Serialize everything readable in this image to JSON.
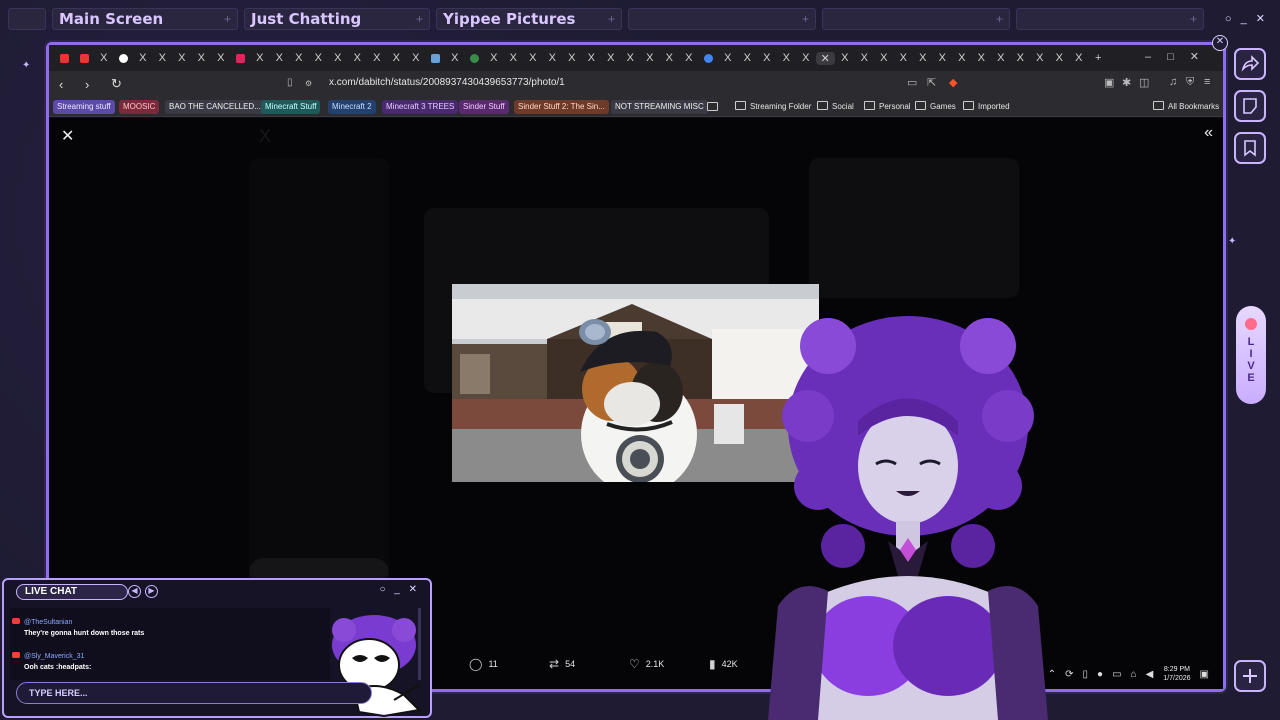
{
  "stream_tabs": [
    {
      "label": ""
    },
    {
      "label": "Main Screen"
    },
    {
      "label": "Just Chatting"
    },
    {
      "label": "Yippee Pictures"
    },
    {
      "label": ""
    },
    {
      "label": ""
    },
    {
      "label": ""
    }
  ],
  "browser": {
    "url": "x.com/dabitch/status/2008937430439653773/photo/1",
    "bookmarks": [
      {
        "label": "Streaming stuff",
        "color": "#5b4aa8",
        "fg": "#f0e6ff"
      },
      {
        "label": "MOOSIC",
        "color": "#7a2a3a",
        "fg": "#ffc2cc"
      },
      {
        "label": "BAO THE CANCELLED...",
        "color": "#3a3a44",
        "fg": "#f0f0f0"
      },
      {
        "label": "Minecraft Stuff",
        "color": "#1f5a5a",
        "fg": "#c8ffff"
      },
      {
        "label": "Minecraft 2",
        "color": "#24406e",
        "fg": "#c8dcff"
      },
      {
        "label": "Minecraft 3 TREES",
        "color": "#4a2a6e",
        "fg": "#e6c8ff"
      },
      {
        "label": "Sinder Stuff",
        "color": "#5a2a6e",
        "fg": "#f0c8ff"
      },
      {
        "label": "Sinder Stuff 2: The Sin...",
        "color": "#6e3a2a",
        "fg": "#ffd8c8"
      },
      {
        "label": "NOT STREAMING MISC",
        "color": "#3a3a44",
        "fg": "#f0f0f0"
      }
    ],
    "folders": [
      "Streaming Folder",
      "Social",
      "Personal",
      "Games",
      "Imported"
    ],
    "all_bookmarks": "All Bookmarks"
  },
  "post": {
    "replies": "11",
    "reposts": "54",
    "likes": "2.1K",
    "views": "42K"
  },
  "taskbar": {
    "time": "8:29 PM",
    "date": "1/7/2026"
  },
  "live_letters": [
    "L",
    "I",
    "V",
    "E"
  ],
  "chat": {
    "title": "LIVE CHAT",
    "messages": [
      {
        "user": "@TheSultanian",
        "text": "They're gonna hunt down those rats"
      },
      {
        "user": "@Sly_Maverick_31",
        "text": "Ooh cats :headpats:"
      }
    ],
    "input_placeholder": "TYPE HERE..."
  }
}
